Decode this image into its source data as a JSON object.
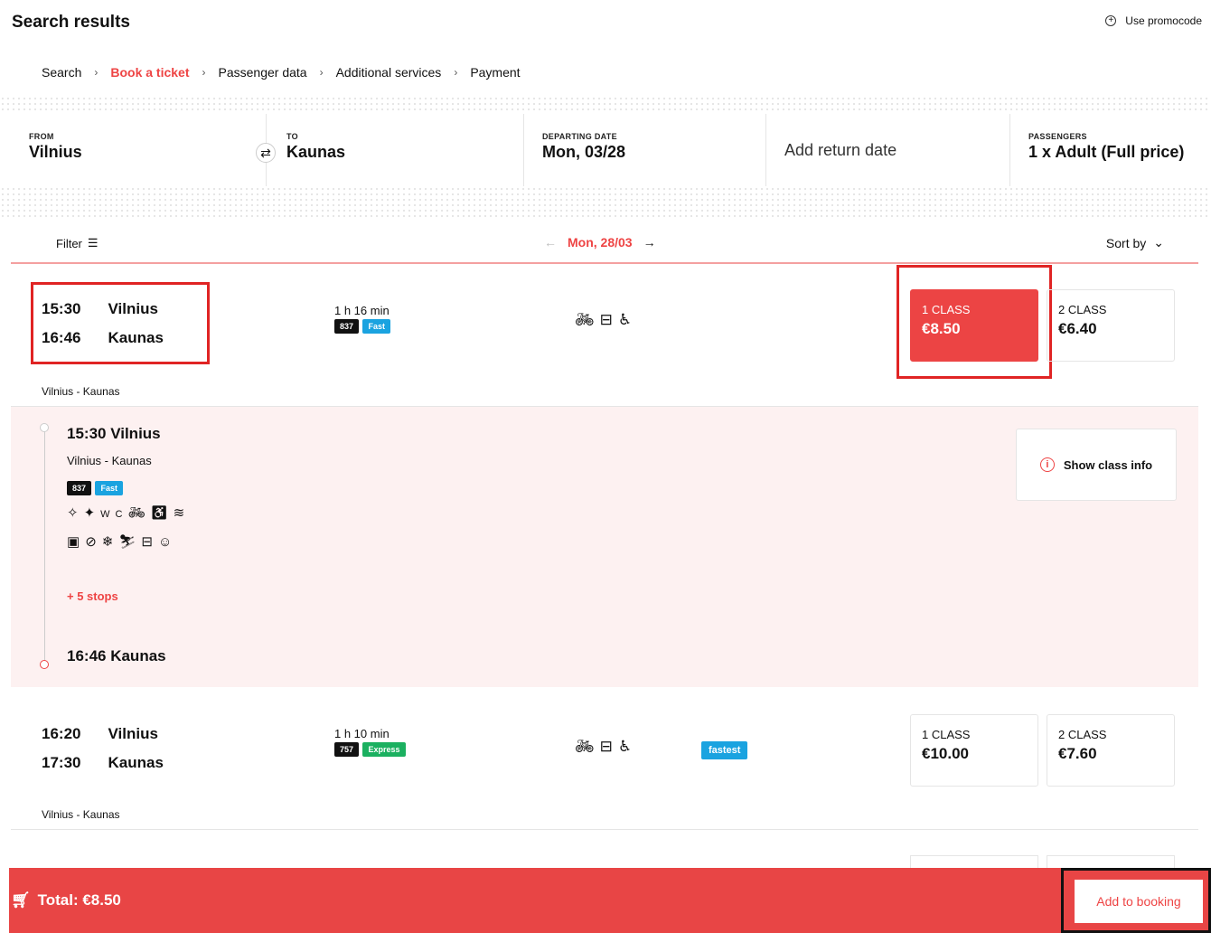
{
  "header": {
    "title": "Search results",
    "promo": "Use promocode"
  },
  "breadcrumb": [
    "Search",
    "Book a ticket",
    "Passenger data",
    "Additional services",
    "Payment"
  ],
  "search": {
    "from_label": "FROM",
    "from": "Vilnius",
    "to_label": "TO",
    "to": "Kaunas",
    "date_label": "DEPARTING DATE",
    "date": "Mon, 03/28",
    "return": "Add return date",
    "pax_label": "PASSENGERS",
    "pax": "1 x Adult (Full price)"
  },
  "toolbar": {
    "filter": "Filter",
    "prev_arrow": "←",
    "date": "Mon, 28/03",
    "next_arrow": "→",
    "sort": "Sort by"
  },
  "trips": [
    {
      "dep_time": "15:30",
      "dep_city": "Vilnius",
      "arr_time": "16:46",
      "arr_city": "Kaunas",
      "duration": "1 h 16 min",
      "train_no": "837",
      "type": "Fast",
      "class1_label": "1 CLASS",
      "class1_price": "€8.50",
      "class2_label": "2 CLASS",
      "class2_price": "€6.40",
      "route": "Vilnius - Kaunas"
    },
    {
      "dep_time": "16:20",
      "dep_city": "Vilnius",
      "arr_time": "17:30",
      "arr_city": "Kaunas",
      "duration": "1 h 10 min",
      "train_no": "757",
      "type": "Express",
      "tag": "fastest",
      "class1_label": "1 CLASS",
      "class1_price": "€10.00",
      "class2_label": "2 CLASS",
      "class2_price": "€7.60",
      "route": "Vilnius - Kaunas"
    }
  ],
  "details": {
    "dep": "15:30 Vilnius",
    "route": "Vilnius - Kaunas",
    "train_no": "837",
    "type": "Fast",
    "stops": "+ 5 stops",
    "arr": "16:46 Kaunas",
    "class_info": "Show class info",
    "amenities_row1": [
      "climate-icon",
      "ac-icon",
      "wc-icon",
      "bike-icon",
      "wheelchair-icon",
      "wifi-icon"
    ],
    "amenities_row2": [
      "luggage-icon",
      "no-pets-icon",
      "snow-icon",
      "ski-icon",
      "food-icon",
      "service-icon"
    ]
  },
  "footer": {
    "total": "Total: €8.50",
    "add": "Add to booking"
  },
  "colors": {
    "accent": "#e84545",
    "fast": "#1aa3e0",
    "express": "#1bb060"
  }
}
